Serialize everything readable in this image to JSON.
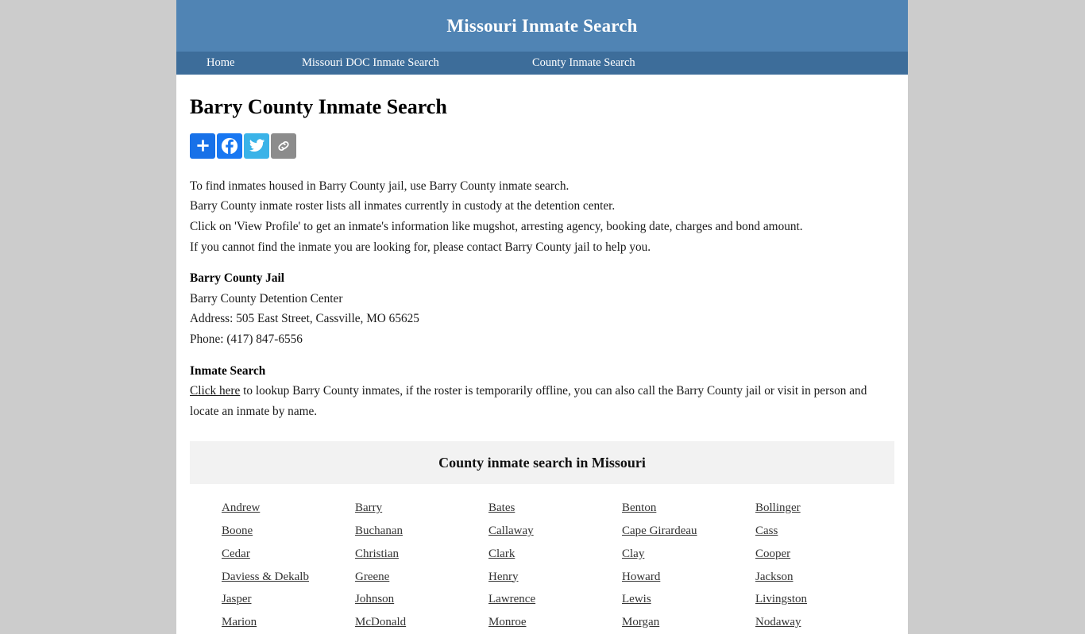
{
  "site": {
    "title": "Missouri Inmate Search",
    "header_bg": "#5084b4",
    "nav_bg": "#3d6d9a"
  },
  "nav": {
    "items": [
      {
        "label": "Home"
      },
      {
        "label": "Missouri DOC Inmate Search"
      },
      {
        "label": "County Inmate Search"
      }
    ]
  },
  "main": {
    "page_title": "Barry County Inmate Search",
    "share_buttons": [
      {
        "name": "addthis-share-button",
        "icon": "plus-icon",
        "color": "#1871e8"
      },
      {
        "name": "facebook-share-button",
        "icon": "facebook-icon",
        "color": "#1877f2"
      },
      {
        "name": "twitter-share-button",
        "icon": "twitter-icon",
        "color": "#3ab3e8"
      },
      {
        "name": "copy-link-share-button",
        "icon": "link-icon",
        "color": "#8c8c8c"
      }
    ],
    "intro_lines": [
      "To find inmates housed in Barry County jail, use Barry County inmate search.",
      "Barry County inmate roster lists all inmates currently in custody at the detention center.",
      "Click on 'View Profile' to get an inmate's information like mugshot, arresting agency, booking date, charges and bond amount.",
      "If you cannot find the inmate you are looking for, please contact Barry County jail to help you."
    ],
    "jail": {
      "heading": "Barry County Jail",
      "facility": "Barry County Detention Center",
      "address": "Address: 505 East Street, Cassville, MO 65625",
      "phone": "Phone: (417) 847-6556"
    },
    "inmate_search": {
      "heading": "Inmate Search",
      "link_text": "Click here",
      "rest_text": " to lookup Barry County inmates, if the roster is temporarily offline, you can also call the Barry County jail or visit in person and locate an inmate by name."
    },
    "county_table": {
      "caption": "County inmate search in Missouri",
      "counties": [
        "Andrew",
        "Barry",
        "Bates",
        "Benton",
        "Bollinger",
        "Boone",
        "Buchanan",
        "Callaway",
        "Cape Girardeau",
        "Cass",
        "Cedar",
        "Christian",
        "Clark",
        "Clay",
        "Cooper",
        "Daviess & Dekalb",
        "Greene",
        "Henry",
        "Howard",
        "Jackson",
        "Jasper",
        "Johnson",
        "Lawrence",
        "Lewis",
        "Livingston",
        "Marion",
        "McDonald",
        "Monroe",
        "Morgan",
        "Nodaway"
      ]
    }
  }
}
